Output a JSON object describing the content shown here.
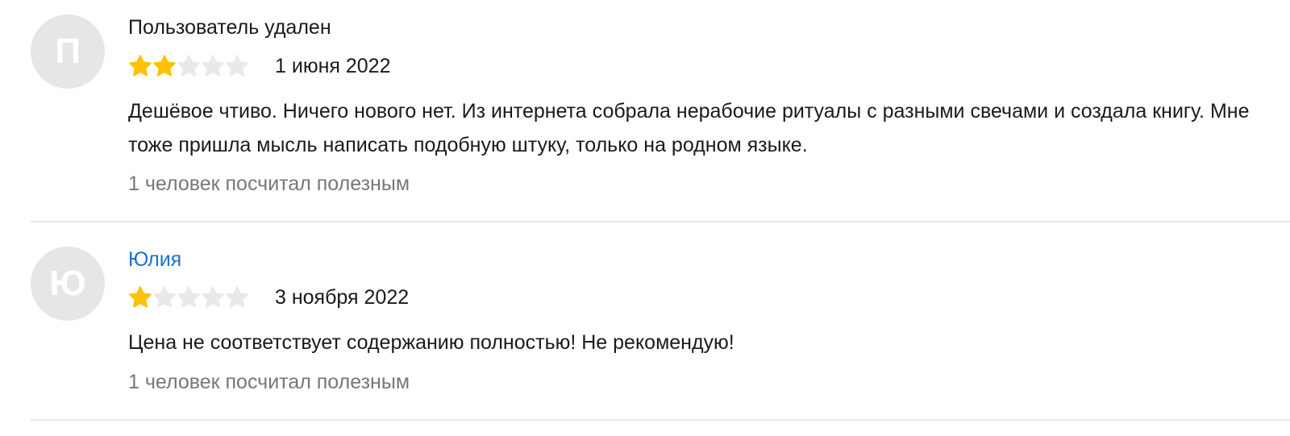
{
  "colors": {
    "star_filled": "#FFC107",
    "star_empty": "#E9E9E9",
    "author_link": "#1A73C9",
    "muted_text": "#777777",
    "avatar_bg": "#E6E6E6"
  },
  "reviews": [
    {
      "avatar_letter": "П",
      "author": "Пользователь удален",
      "rating": 2,
      "rating_max": 5,
      "date": "1 июня 2022",
      "text": "Дешёвое чтиво. Ничего нового нет. Из интернета собрала нерабочие ритуалы с разными свечами и создала книгу. Мне тоже пришла мысль написать подобную штуку, только на родном языке.",
      "helpful": "1 человек посчитал полезным"
    },
    {
      "avatar_letter": "Ю",
      "author": "Юлия",
      "rating": 1,
      "rating_max": 5,
      "date": "3 ноября 2022",
      "text": "Цена не соответствует содержанию полностью! Не рекомендую!",
      "helpful": "1 человек посчитал полезным"
    }
  ]
}
